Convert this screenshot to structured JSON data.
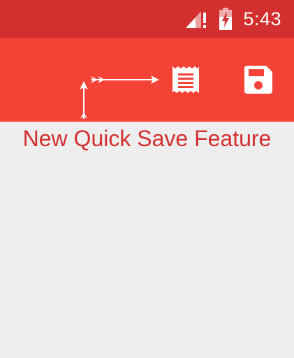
{
  "status_bar": {
    "time": "5:43",
    "icons": [
      "cell-signal-icon",
      "battery-charging-icon"
    ]
  },
  "toolbar": {
    "icons": [
      "receipt-icon",
      "save-icon"
    ]
  },
  "annotation": {
    "caption": "New Quick Save Feature"
  },
  "colors": {
    "status_bar": "#d32f2f",
    "toolbar": "#f44336",
    "background": "#eeeeee",
    "caption": "#d32f2f",
    "icon": "#ffffff"
  }
}
